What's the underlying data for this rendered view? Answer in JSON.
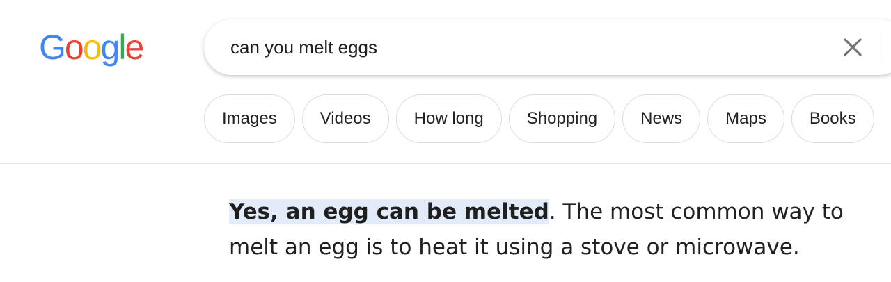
{
  "logo": {
    "letters": [
      "G",
      "o",
      "o",
      "g",
      "l",
      "e"
    ],
    "colors": [
      "#4285f4",
      "#ea4335",
      "#fbbc05",
      "#4285f4",
      "#34a853",
      "#ea4335"
    ]
  },
  "search": {
    "query": "can you melt eggs",
    "clear_icon": "close-icon"
  },
  "chips": [
    "Images",
    "Videos",
    "How long",
    "Shopping",
    "News",
    "Maps",
    "Books"
  ],
  "answer": {
    "highlight": "Yes, an egg can be melted",
    "text": ". The most common way to melt an egg is to heat it using a stove or microwave.",
    "highlight_color": "#e3eaf8"
  }
}
